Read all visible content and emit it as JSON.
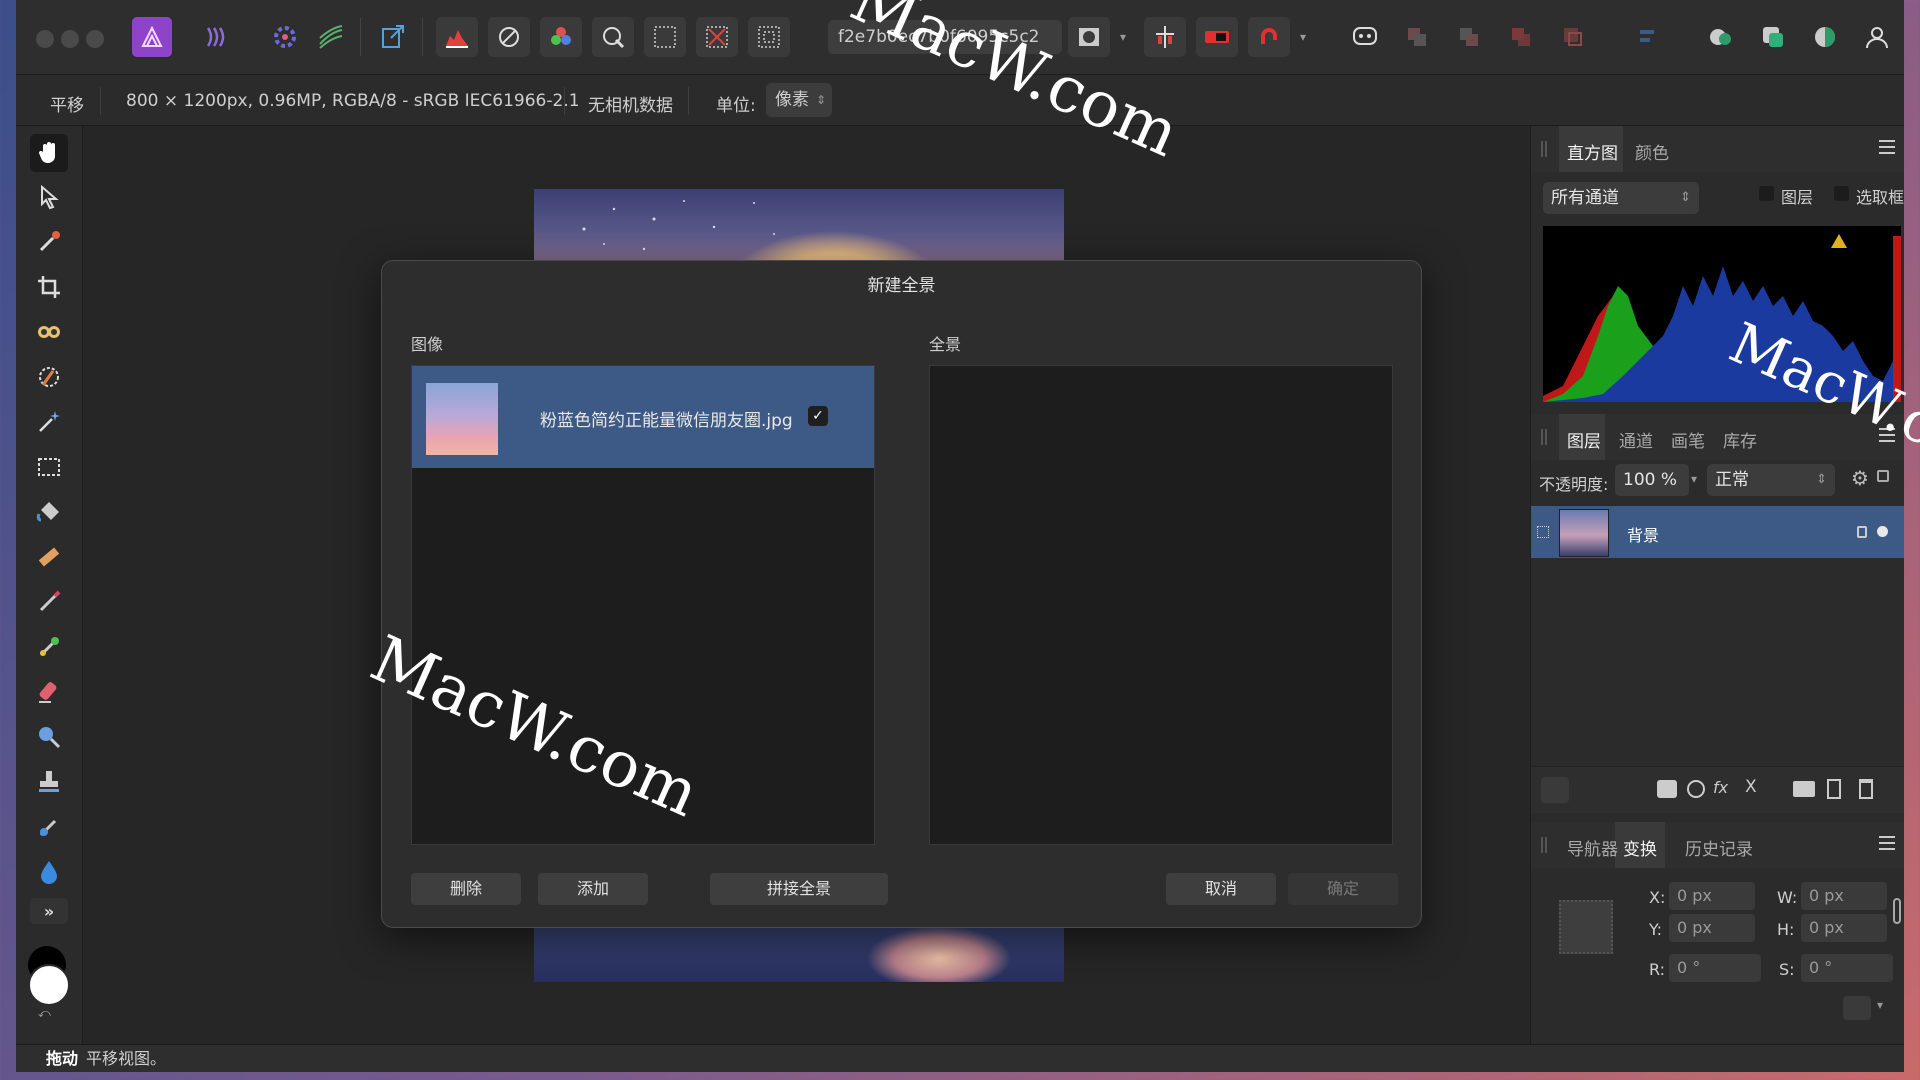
{
  "toolbar": {
    "hash_field": "f2e7b0ec7b0f6095c5c2"
  },
  "context": {
    "tool_name": "平移",
    "doc_info": "800 × 1200px, 0.96MP, RGBA/8 - sRGB IEC61966-2.1",
    "camera": "无相机数据",
    "unit_label": "单位:",
    "unit_value": "像素"
  },
  "histogram": {
    "tabs": [
      "直方图",
      "颜色"
    ],
    "channel": "所有通道",
    "opt_layer": "图层",
    "opt_selection": "选取框"
  },
  "layers": {
    "tabs": [
      "图层",
      "通道",
      "画笔",
      "库存"
    ],
    "opacity_label": "不透明度:",
    "opacity_value": "100 %",
    "blend_mode": "正常",
    "layer_name": "背景"
  },
  "transform": {
    "tabs": [
      "导航器",
      "变换",
      "历史记录"
    ],
    "x_label": "X:",
    "x_value": "0 px",
    "y_label": "Y:",
    "y_value": "0 px",
    "w_label": "W:",
    "w_value": "0 px",
    "h_label": "H:",
    "h_value": "0 px",
    "r_label": "R:",
    "r_value": "0 °",
    "s_label": "S:",
    "s_value": "0 °"
  },
  "status": {
    "bold": "拖动",
    "text": "平移视图。"
  },
  "dialog": {
    "title": "新建全景",
    "images_label": "图像",
    "panorama_label": "全景",
    "image_item": "粉蓝色简约正能量微信朋友圈.jpg",
    "btn_delete": "删除",
    "btn_add": "添加",
    "btn_stitch": "拼接全景",
    "btn_cancel": "取消",
    "btn_ok": "确定"
  },
  "watermark": "MacW.com",
  "colors": {
    "accent": "#3d5a86",
    "app_icon": "#8e44c9",
    "window_bg": "#282828"
  }
}
